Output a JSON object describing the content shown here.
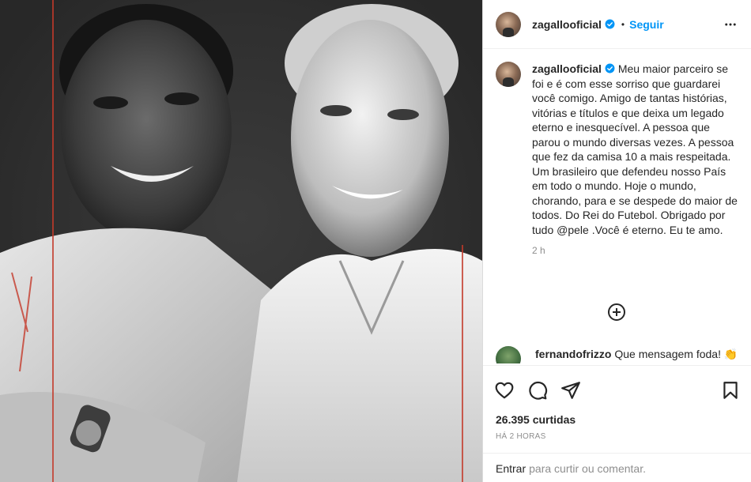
{
  "post": {
    "username": "zagallooficial",
    "separator": "•",
    "follow_label": "Seguir",
    "more_icon": "more-horizontal-icon",
    "verified_color": "#0095f6"
  },
  "caption": {
    "username": "zagallooficial",
    "text": "Meu maior parceiro se foi e é com esse sorriso que guardarei você comigo. Amigo de tantas histórias, vitórias e títulos e que deixa um legado eterno e inesquecível. A pessoa que parou o mundo diversas vezes. A pessoa que fez da camisa 10 a mais respeitada. Um brasileiro que defendeu nosso País em todo o mundo. Hoje o mundo, chorando, para e se despede do maior de todos. Do Rei do Futebol. Obrigado por tudo @pele .Você é eterno. Eu te amo.",
    "time": "2 h"
  },
  "load_more_icon": "plus-circle-icon",
  "comment": {
    "username": "fernandofrizzo",
    "text": "Que mensagem foda! 👏"
  },
  "actions": {
    "like_icon": "heart-icon",
    "comment_icon": "comment-icon",
    "share_icon": "send-icon",
    "save_icon": "bookmark-icon"
  },
  "likes": "26.395 curtidas",
  "posted_ago": "HÁ 2 HORAS",
  "add_comment": {
    "enter_label": "Entrar",
    "rest_text": "para curtir ou comentar."
  }
}
